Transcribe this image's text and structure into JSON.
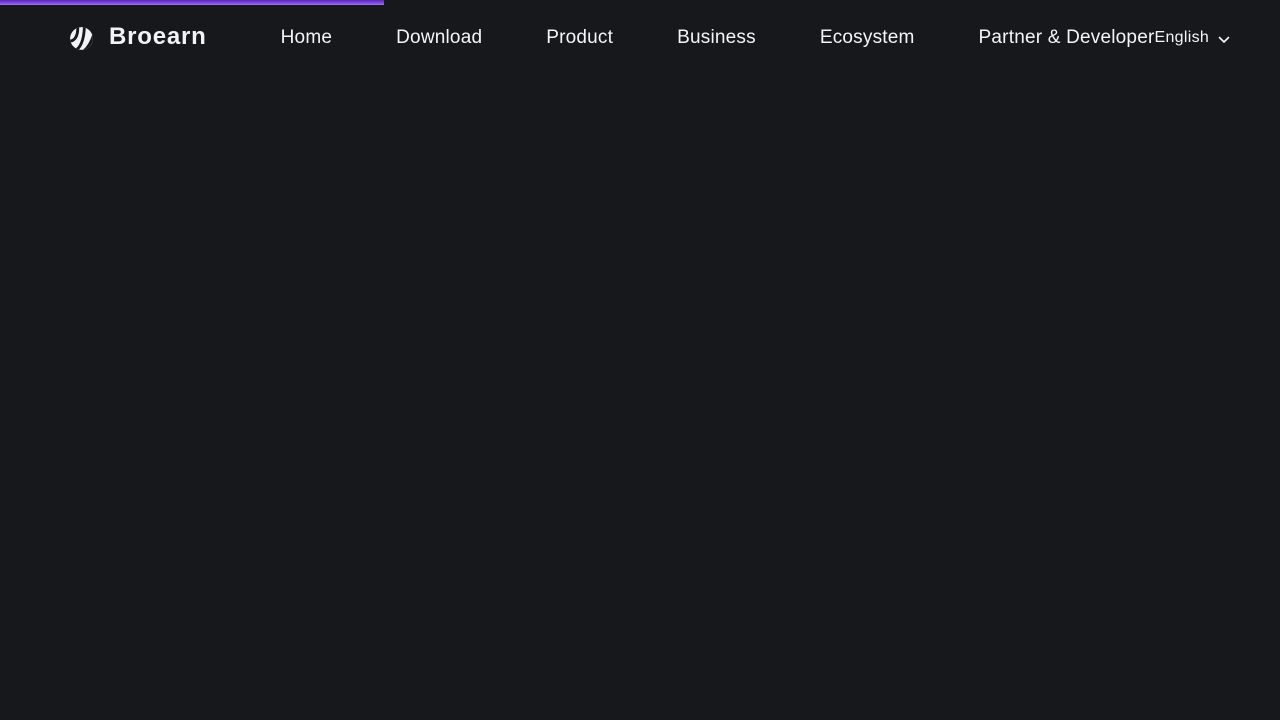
{
  "page": {
    "background_color": "#17181b",
    "accent_color": "#7b46e3"
  },
  "progress_bar": {
    "progress_percent": 30,
    "color_top": "#5a27b8",
    "color_bottom": "#9d74f5"
  },
  "header": {
    "logo": {
      "brand": "Broearn",
      "icon": "broearn-striped-sphere-logo"
    },
    "nav_items": [
      {
        "label": "Home"
      },
      {
        "label": "Download"
      },
      {
        "label": "Product"
      },
      {
        "label": "Business"
      },
      {
        "label": "Ecosystem"
      },
      {
        "label": "Partner & Developer"
      }
    ],
    "language_selector": {
      "selected": "English",
      "icon": "chevron-down-icon"
    }
  }
}
